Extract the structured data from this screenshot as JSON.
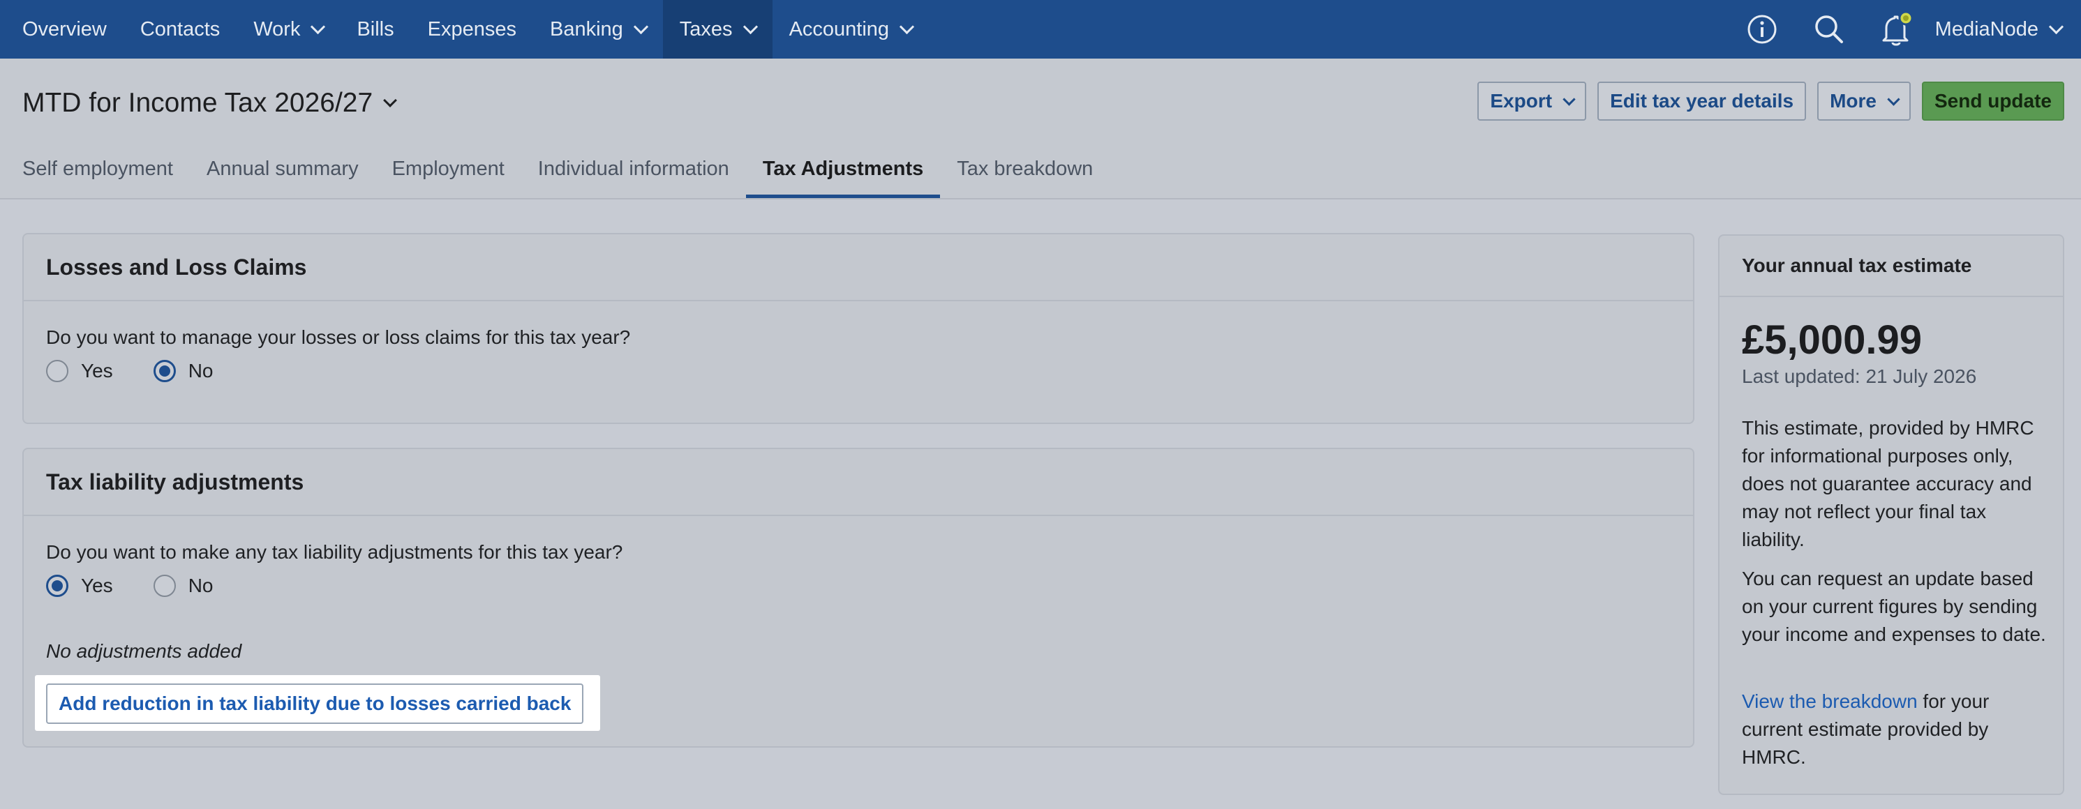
{
  "nav": {
    "items": [
      {
        "label": "Overview",
        "dropdown": false
      },
      {
        "label": "Contacts",
        "dropdown": false
      },
      {
        "label": "Work",
        "dropdown": true
      },
      {
        "label": "Bills",
        "dropdown": false
      },
      {
        "label": "Expenses",
        "dropdown": false
      },
      {
        "label": "Banking",
        "dropdown": true
      },
      {
        "label": "Taxes",
        "dropdown": true,
        "active": true
      },
      {
        "label": "Accounting",
        "dropdown": true
      }
    ],
    "icons": [
      "info-icon",
      "search-icon",
      "bell-icon"
    ],
    "org_name": "MediaNode"
  },
  "header": {
    "title": "MTD for Income Tax 2026/27",
    "actions": {
      "export": "Export",
      "edit": "Edit tax year details",
      "more": "More",
      "send": "Send update"
    },
    "tabs": [
      {
        "label": "Self employment"
      },
      {
        "label": "Annual summary"
      },
      {
        "label": "Employment"
      },
      {
        "label": "Individual information"
      },
      {
        "label": "Tax Adjustments",
        "active": true
      },
      {
        "label": "Tax breakdown"
      }
    ]
  },
  "losses": {
    "title": "Losses and Loss Claims",
    "question": "Do you want to manage your losses or loss claims for this tax year?",
    "yes_label": "Yes",
    "no_label": "No",
    "selected": "No"
  },
  "liability": {
    "title": "Tax liability adjustments",
    "question": "Do you want to make any tax liability adjustments for this tax year?",
    "yes_label": "Yes",
    "no_label": "No",
    "selected": "Yes",
    "empty_text": "No adjustments added",
    "add_button": "Add reduction in tax liability due to losses carried back"
  },
  "estimate": {
    "title": "Your annual tax estimate",
    "amount": "£5,000.99",
    "updated": "Last updated: 21 July 2026",
    "para1": "This estimate, provided by HMRC for informational purposes only, does not guarantee accuracy and may not reflect your final tax liability.",
    "para2": "You can request an update based on your current figures by sending your income and expenses to date.",
    "link_text": "View the breakdown",
    "link_suffix": " for your current estimate provided by HMRC."
  },
  "colors": {
    "nav_bg": "#1e4d8c",
    "accent": "#1e4d8c",
    "link": "#1c5bb0",
    "primary_button": "#5a9a52"
  }
}
